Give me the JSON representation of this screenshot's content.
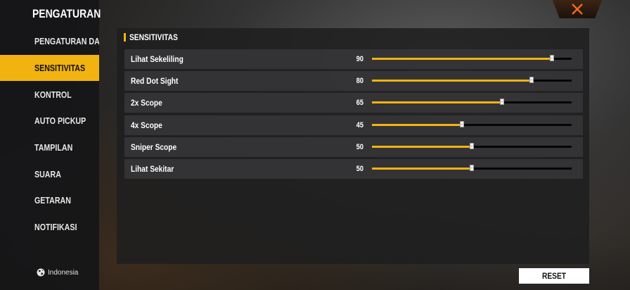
{
  "sidebar": {
    "title": "PENGATURAN",
    "items": [
      {
        "label": "PENGATURAN DASAR",
        "active": false
      },
      {
        "label": "SENSITIVITAS",
        "active": true
      },
      {
        "label": "KONTROL",
        "active": false
      },
      {
        "label": "AUTO PICKUP",
        "active": false
      },
      {
        "label": "TAMPILAN",
        "active": false
      },
      {
        "label": "SUARA",
        "active": false
      },
      {
        "label": "GETARAN",
        "active": false
      },
      {
        "label": "NOTIFIKASI",
        "active": false
      }
    ],
    "language": {
      "label": "Indonesia",
      "icon": "globe-icon"
    }
  },
  "header": {
    "close_icon": "close-icon"
  },
  "panel": {
    "title": "SENSITIVITAS",
    "max_value": 100,
    "sliders": [
      {
        "label": "Lihat Sekeliling",
        "value": 90
      },
      {
        "label": "Red Dot Sight",
        "value": 80
      },
      {
        "label": "2x Scope",
        "value": 65
      },
      {
        "label": "4x Scope",
        "value": 45
      },
      {
        "label": "Sniper Scope",
        "value": 50
      },
      {
        "label": "Lihat Sekitar",
        "value": 50
      }
    ]
  },
  "footer": {
    "reset_label": "RESET"
  },
  "colors": {
    "accent": "#f2b311",
    "close": "#f36a1e"
  }
}
